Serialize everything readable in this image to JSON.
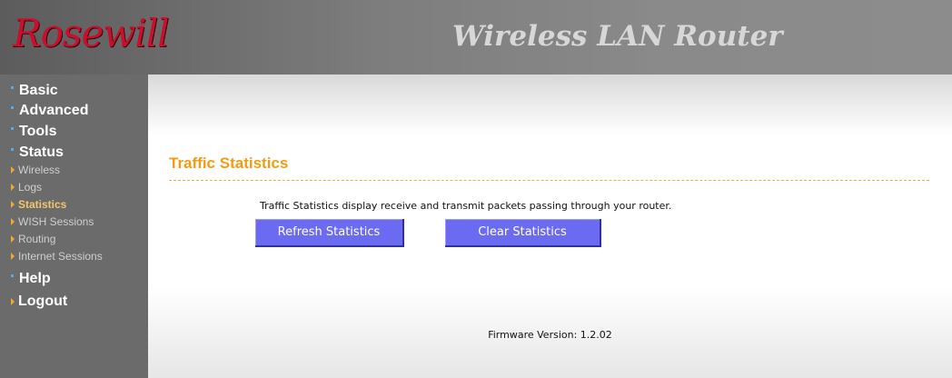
{
  "header": {
    "logo_text": "Rosewill",
    "logo_mark": "®",
    "product_title": "Wireless LAN Router"
  },
  "sidebar": {
    "items": [
      {
        "label": "Basic",
        "level": "main"
      },
      {
        "label": "Advanced",
        "level": "main"
      },
      {
        "label": "Tools",
        "level": "main"
      },
      {
        "label": "Status",
        "level": "main"
      },
      {
        "label": "Wireless",
        "level": "sub"
      },
      {
        "label": "Logs",
        "level": "sub"
      },
      {
        "label": "Statistics",
        "level": "sub",
        "active": true
      },
      {
        "label": "WISH Sessions",
        "level": "sub"
      },
      {
        "label": "Routing",
        "level": "sub"
      },
      {
        "label": "Internet Sessions",
        "level": "sub"
      },
      {
        "label": "Help",
        "level": "main"
      },
      {
        "label": "Logout",
        "level": "main"
      }
    ]
  },
  "main": {
    "title": "Traffic Statistics",
    "description": "Traffic Statistics display receive and transmit packets passing through your router.",
    "refresh_label": "Refresh Statistics",
    "clear_label": "Clear Statistics",
    "firmware": "Firmware Version: 1.2.02"
  },
  "colors": {
    "title_orange": "#f39c12",
    "button_blue": "#6b6bf2",
    "logo_red": "#c8102e",
    "sidebar_gray": "#6b6b6b"
  }
}
